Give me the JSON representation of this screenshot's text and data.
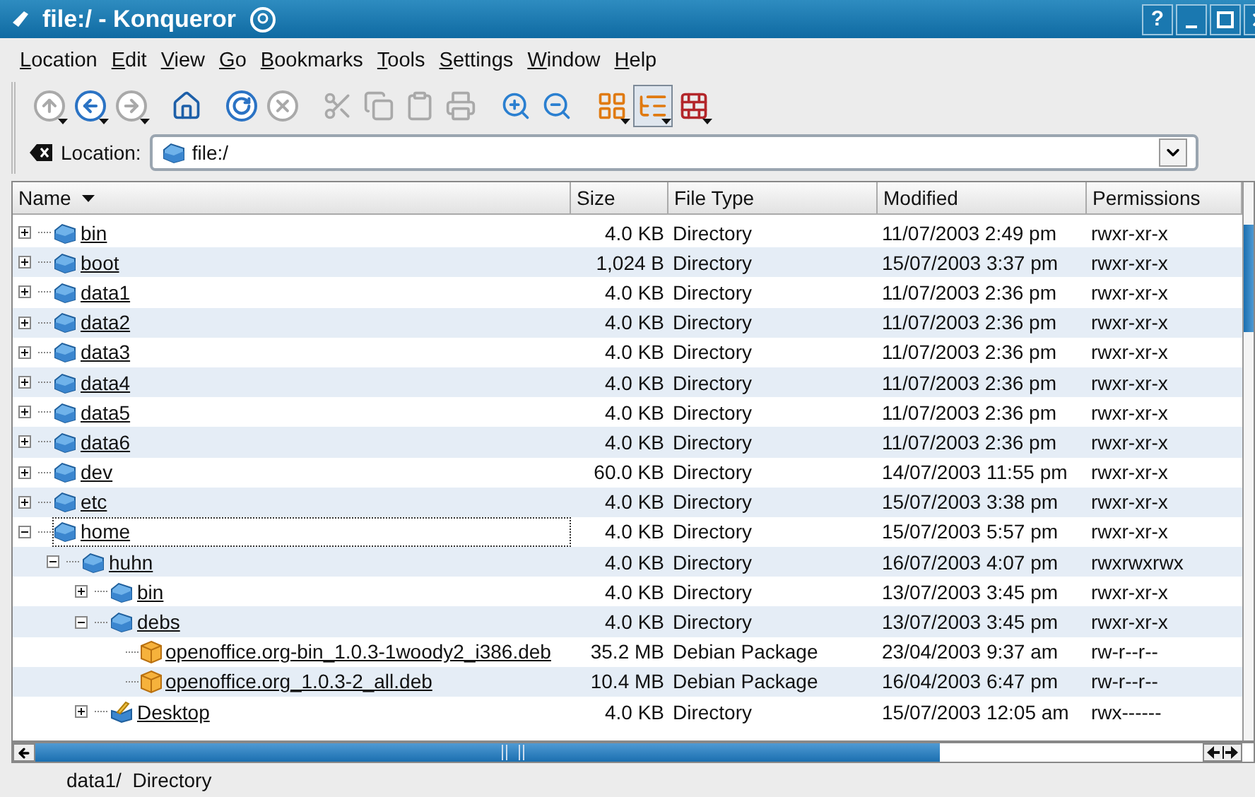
{
  "window": {
    "title": "file:/ - Konqueror",
    "title_buttons": [
      "?"
    ]
  },
  "menu": [
    "Location",
    "Edit",
    "View",
    "Go",
    "Bookmarks",
    "Tools",
    "Settings",
    "Window",
    "Help"
  ],
  "toolbar": [
    {
      "kind": "up",
      "disabled": true,
      "menu": true,
      "selected": false
    },
    {
      "kind": "back",
      "disabled": false,
      "menu": true,
      "selected": false
    },
    {
      "kind": "forward",
      "disabled": true,
      "menu": true,
      "selected": false
    },
    {
      "kind": "home",
      "disabled": false,
      "menu": false,
      "selected": false
    },
    {
      "kind": "reload",
      "disabled": false,
      "menu": false,
      "selected": false
    },
    {
      "kind": "stop",
      "disabled": true,
      "menu": false,
      "selected": false
    },
    {
      "kind": "cut",
      "disabled": true,
      "menu": false,
      "selected": false
    },
    {
      "kind": "copy",
      "disabled": true,
      "menu": false,
      "selected": false
    },
    {
      "kind": "paste",
      "disabled": true,
      "menu": false,
      "selected": false
    },
    {
      "kind": "print",
      "disabled": true,
      "menu": false,
      "selected": false
    },
    {
      "kind": "zoom-in",
      "disabled": false,
      "menu": false,
      "selected": false
    },
    {
      "kind": "zoom-out",
      "disabled": false,
      "menu": false,
      "selected": false
    },
    {
      "kind": "icon-view",
      "disabled": false,
      "menu": true,
      "selected": false
    },
    {
      "kind": "tree-view",
      "disabled": false,
      "menu": true,
      "selected": true
    },
    {
      "kind": "firewall",
      "disabled": false,
      "menu": true,
      "selected": false
    }
  ],
  "location": {
    "label": "Location:",
    "value": "file:/"
  },
  "columns": [
    "Name",
    "Size",
    "File Type",
    "Modified",
    "Permissions"
  ],
  "files": [
    {
      "kind": "folder",
      "name": "bin",
      "size": "4.0 KB",
      "type": "Directory",
      "modified": "11/07/2003 2:49 pm",
      "permissions": "rwxr-xr-x",
      "expanded": false,
      "focused": false
    },
    {
      "kind": "folder",
      "name": "boot",
      "size": "1,024 B",
      "type": "Directory",
      "modified": "15/07/2003 3:37 pm",
      "permissions": "rwxr-xr-x",
      "expanded": false,
      "focused": false
    },
    {
      "kind": "folder",
      "name": "data1",
      "size": "4.0 KB",
      "type": "Directory",
      "modified": "11/07/2003 2:36 pm",
      "permissions": "rwxr-xr-x",
      "expanded": false,
      "focused": false
    },
    {
      "kind": "folder",
      "name": "data2",
      "size": "4.0 KB",
      "type": "Directory",
      "modified": "11/07/2003 2:36 pm",
      "permissions": "rwxr-xr-x",
      "expanded": false,
      "focused": false
    },
    {
      "kind": "folder",
      "name": "data3",
      "size": "4.0 KB",
      "type": "Directory",
      "modified": "11/07/2003 2:36 pm",
      "permissions": "rwxr-xr-x",
      "expanded": false,
      "focused": false
    },
    {
      "kind": "folder",
      "name": "data4",
      "size": "4.0 KB",
      "type": "Directory",
      "modified": "11/07/2003 2:36 pm",
      "permissions": "rwxr-xr-x",
      "expanded": false,
      "focused": false
    },
    {
      "kind": "folder",
      "name": "data5",
      "size": "4.0 KB",
      "type": "Directory",
      "modified": "11/07/2003 2:36 pm",
      "permissions": "rwxr-xr-x",
      "expanded": false,
      "focused": false
    },
    {
      "kind": "folder",
      "name": "data6",
      "size": "4.0 KB",
      "type": "Directory",
      "modified": "11/07/2003 2:36 pm",
      "permissions": "rwxr-xr-x",
      "expanded": false,
      "focused": false
    },
    {
      "kind": "folder",
      "name": "dev",
      "size": "60.0 KB",
      "type": "Directory",
      "modified": "14/07/2003 11:55 pm",
      "permissions": "rwxr-xr-x",
      "expanded": false,
      "focused": false
    },
    {
      "kind": "folder",
      "name": "etc",
      "size": "4.0 KB",
      "type": "Directory",
      "modified": "15/07/2003 3:38 pm",
      "permissions": "rwxr-xr-x",
      "expanded": false,
      "focused": false
    },
    {
      "kind": "folder",
      "name": "home",
      "size": "4.0 KB",
      "type": "Directory",
      "modified": "15/07/2003 5:57 pm",
      "permissions": "rwxr-xr-x",
      "expanded": true,
      "focused": true,
      "children": [
        {
          "kind": "folder",
          "name": "huhn",
          "size": "4.0 KB",
          "type": "Directory",
          "modified": "16/07/2003 4:07 pm",
          "permissions": "rwxrwxrwx",
          "expanded": true,
          "focused": false,
          "children": [
            {
              "kind": "folder",
              "name": "bin",
              "size": "4.0 KB",
              "type": "Directory",
              "modified": "13/07/2003 3:45 pm",
              "permissions": "rwxr-xr-x",
              "expanded": false,
              "focused": false
            },
            {
              "kind": "folder",
              "name": "debs",
              "size": "4.0 KB",
              "type": "Directory",
              "modified": "13/07/2003 3:45 pm",
              "permissions": "rwxr-xr-x",
              "expanded": true,
              "focused": false,
              "children": [
                {
                  "kind": "package",
                  "name": "openoffice.org-bin_1.0.3-1woody2_i386.deb",
                  "size": "35.2 MB",
                  "type": "Debian Package",
                  "modified": "23/04/2003 9:37 am",
                  "permissions": "rw-r--r--",
                  "focused": false
                },
                {
                  "kind": "package",
                  "name": "openoffice.org_1.0.3-2_all.deb",
                  "size": "10.4 MB",
                  "type": "Debian Package",
                  "modified": "16/04/2003 6:47 pm",
                  "permissions": "rw-r--r--",
                  "focused": false
                }
              ]
            },
            {
              "kind": "desktop",
              "name": "Desktop",
              "size": "4.0 KB",
              "type": "Directory",
              "modified": "15/07/2003 12:05 am",
              "permissions": "rwx------",
              "expanded": false,
              "focused": false
            }
          ]
        }
      ]
    }
  ],
  "status_bar": "data1/  Directory"
}
